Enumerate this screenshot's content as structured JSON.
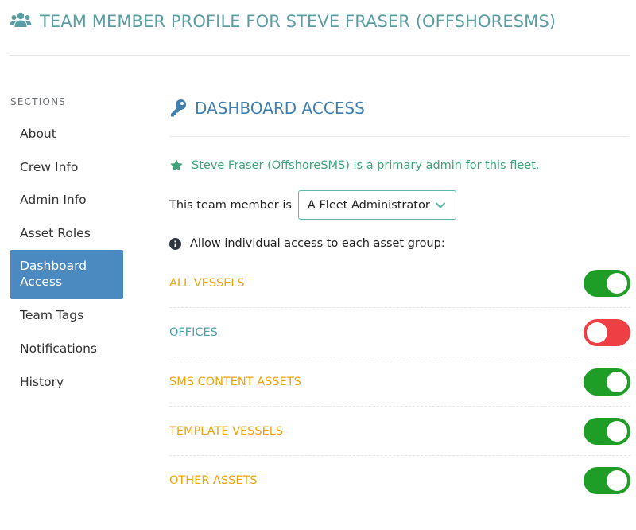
{
  "header": {
    "title": "TEAM MEMBER PROFILE FOR STEVE FRASER (OFFSHORESMS)",
    "icon": "users-icon"
  },
  "sidebar": {
    "heading": "SECTIONS",
    "items": [
      {
        "label": "About",
        "active": false
      },
      {
        "label": "Crew Info",
        "active": false
      },
      {
        "label": "Admin Info",
        "active": false
      },
      {
        "label": "Asset Roles",
        "active": false
      },
      {
        "label": "Dashboard Access",
        "active": true
      },
      {
        "label": "Team Tags",
        "active": false
      },
      {
        "label": "Notifications",
        "active": false
      },
      {
        "label": "History",
        "active": false
      }
    ]
  },
  "main": {
    "section_title": "DASHBOARD ACCESS",
    "section_icon": "key-icon",
    "admin_note": "Steve Fraser (OffshoreSMS) is a primary admin for this fleet.",
    "member_label": "This team member is",
    "role_select": {
      "value": "A Fleet Administrator"
    },
    "allow_note": "Allow individual access to each asset group:",
    "groups": [
      {
        "label": "ALL VESSELS",
        "enabled": true
      },
      {
        "label": "OFFICES",
        "enabled": false
      },
      {
        "label": "SMS CONTENT ASSETS",
        "enabled": true
      },
      {
        "label": "TEMPLATE VESSELS",
        "enabled": true
      },
      {
        "label": "OTHER ASSETS",
        "enabled": true
      }
    ]
  },
  "colors": {
    "header_teal": "#5a9ea3",
    "section_blue": "#3f7fae",
    "active_nav": "#4a8ac0",
    "note_green": "#3ea37a",
    "group_orange": "#f0a30a",
    "group_teal": "#4aa1a8",
    "toggle_on": "#1e9e27",
    "toggle_off": "#ee3f44"
  }
}
